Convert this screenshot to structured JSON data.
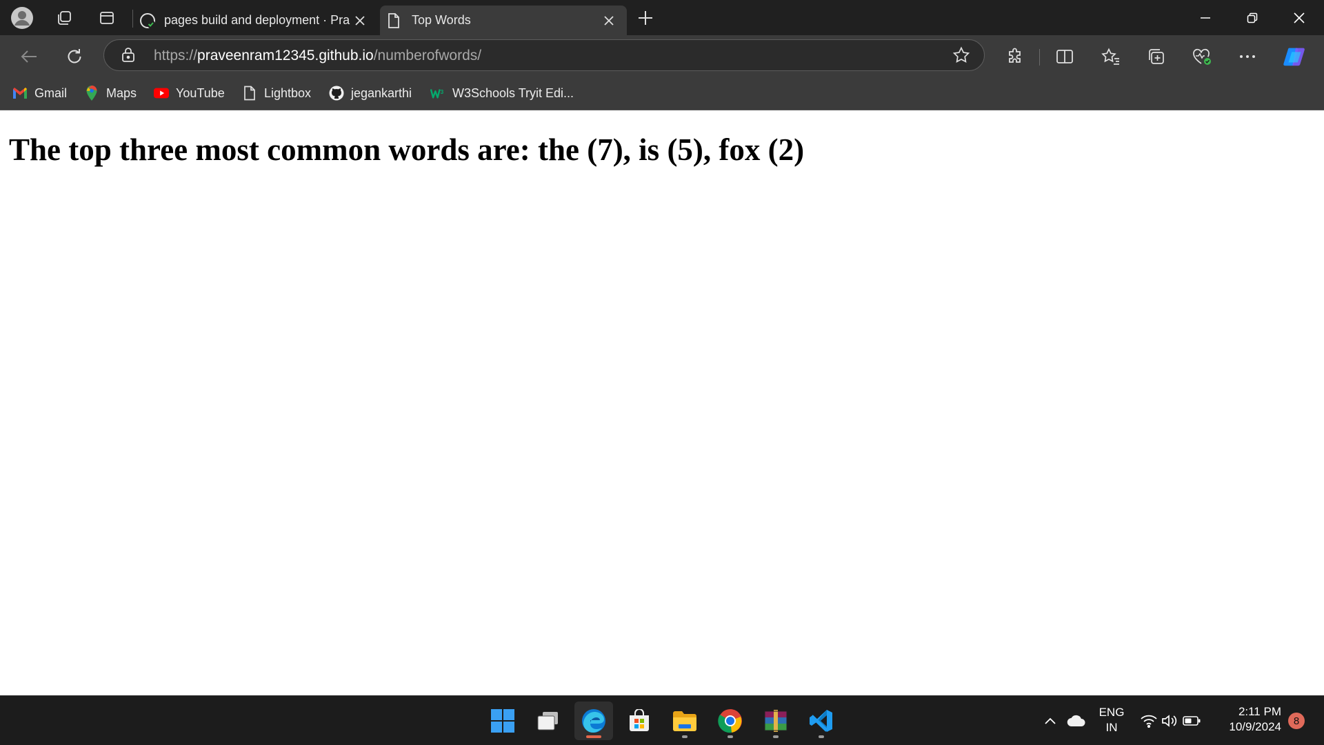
{
  "tabs": [
    {
      "title": "pages build and deployment · Pra",
      "icon": "github-check-icon",
      "active": false
    },
    {
      "title": "Top Words",
      "icon": "page-icon",
      "active": true
    }
  ],
  "address": {
    "scheme": "https://",
    "host": "praveenram12345.github.io",
    "path": "/numberofwords/"
  },
  "favorites": [
    {
      "label": "Gmail",
      "icon": "gmail-icon"
    },
    {
      "label": "Maps",
      "icon": "maps-icon"
    },
    {
      "label": "YouTube",
      "icon": "youtube-icon"
    },
    {
      "label": "Lightbox",
      "icon": "page-icon"
    },
    {
      "label": "jegankarthi",
      "icon": "github-icon"
    },
    {
      "label": "W3Schools Tryit Edi...",
      "icon": "w3schools-icon"
    }
  ],
  "page": {
    "heading": "The top three most common words are: the (7), is (5), fox (2)"
  },
  "tray": {
    "lang_line1": "ENG",
    "lang_line2": "IN",
    "time": "2:11 PM",
    "date": "10/9/2024",
    "notification_count": "8"
  },
  "colors": {
    "tabstrip": "#202020",
    "toolbar": "#3b3b3b",
    "taskbar": "#1c1c1c",
    "active_indicator": "#e2674a"
  }
}
